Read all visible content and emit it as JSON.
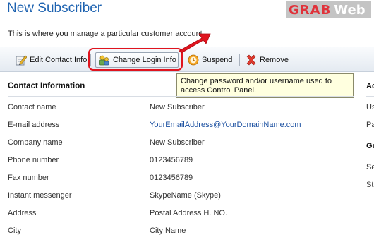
{
  "header": {
    "title": "New Subscriber",
    "description": "This is where you manage a particular customer account"
  },
  "logo": {
    "part1": "GRAB",
    "part2": "Web"
  },
  "toolbar": {
    "edit_label": "Edit Contact Info",
    "login_label": "Change Login Info",
    "suspend_label": "Suspend",
    "remove_label": "Remove"
  },
  "tooltip": {
    "text": "Change password and/or username used to access Control Panel."
  },
  "contact": {
    "section_title": "Contact Information",
    "rows": [
      {
        "label": "Contact name",
        "value": "New Subscriber"
      },
      {
        "label": "E-mail address",
        "value": "YourEmailAddress@YourDomainName.com"
      },
      {
        "label": "Company name",
        "value": "New Subscriber"
      },
      {
        "label": "Phone number",
        "value": "0123456789"
      },
      {
        "label": "Fax number",
        "value": "0123456789"
      },
      {
        "label": "Instant messenger",
        "value": "SkypeName (Skype)"
      },
      {
        "label": "Address",
        "value": "Postal Address H. NO."
      },
      {
        "label": "City",
        "value": "City Name"
      }
    ]
  },
  "right_column": {
    "heading1": "Ac",
    "item1": "Us",
    "item2": "Pa",
    "heading2": "Ge",
    "item3": "Se",
    "item4": "St"
  },
  "colors": {
    "title_blue": "#1d62b0",
    "highlight_red": "#e0141e",
    "tooltip_bg": "#ffffdf",
    "link_blue": "#1a4fa0"
  }
}
